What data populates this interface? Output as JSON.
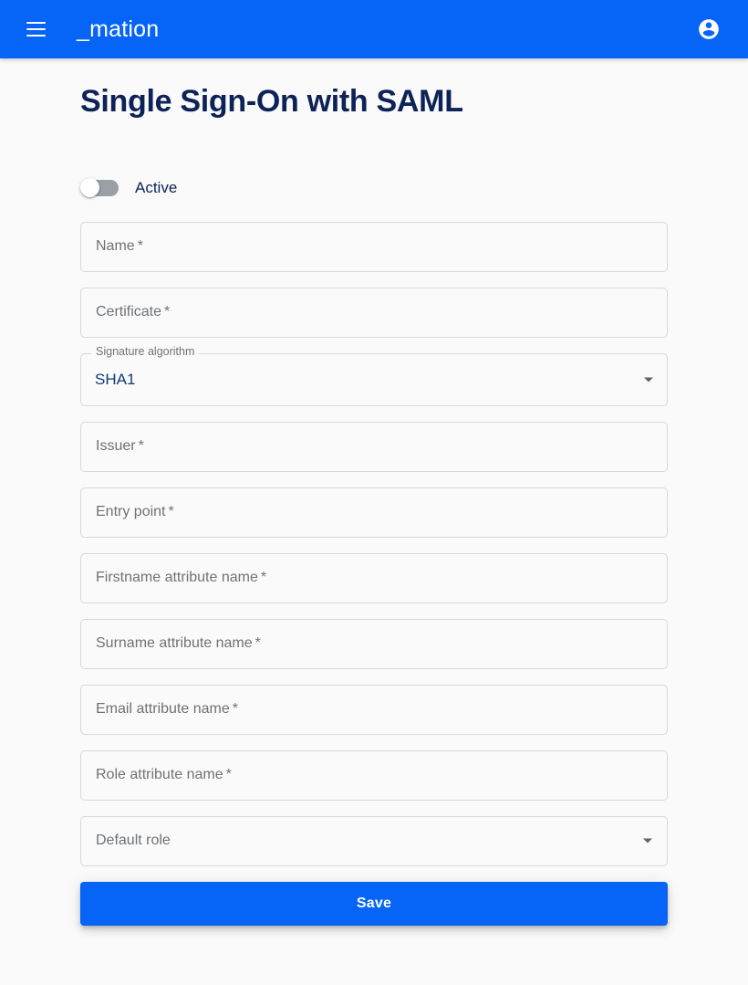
{
  "appbar": {
    "menu_label": "Menu",
    "brand": "_mation",
    "account_label": "Account",
    "background_color": "#0664f7"
  },
  "page": {
    "title": "Single Sign-On with SAML",
    "title_color": "#0d2257",
    "background_color": "#fafafa"
  },
  "toggle": {
    "label": "Active",
    "state": "off",
    "track_color": "#9aa0a6",
    "knob_color": "#ffffff"
  },
  "form": {
    "fields": [
      {
        "name": "name",
        "placeholder": "Name",
        "required_mark": "*",
        "value": "",
        "type": "text"
      },
      {
        "name": "certificate",
        "placeholder": "Certificate",
        "required_mark": "*",
        "value": "",
        "type": "text"
      },
      {
        "name": "signature_algorithm",
        "placeholder": "Signature algorithm",
        "required_mark": "",
        "value": "SHA1",
        "type": "select"
      },
      {
        "name": "issuer",
        "placeholder": "Issuer",
        "required_mark": "*",
        "value": "",
        "type": "text"
      },
      {
        "name": "entry_point",
        "placeholder": "Entry point",
        "required_mark": "*",
        "value": "",
        "type": "text"
      },
      {
        "name": "firstname_attribute_name",
        "placeholder": "Firstname attribute name",
        "required_mark": "*",
        "value": "",
        "type": "text"
      },
      {
        "name": "surname_attribute_name",
        "placeholder": "Surname attribute name",
        "required_mark": "*",
        "value": "",
        "type": "text"
      },
      {
        "name": "email_attribute_name",
        "placeholder": "Email attribute name",
        "required_mark": "*",
        "value": "",
        "type": "text"
      },
      {
        "name": "role_attribute_name",
        "placeholder": "Role attribute name",
        "required_mark": "*",
        "value": "",
        "type": "text"
      },
      {
        "name": "default_role",
        "placeholder": "Default role",
        "required_mark": "",
        "value": "",
        "type": "select"
      }
    ],
    "field_labels": {
      "name": "Name",
      "name_req": "*",
      "certificate": "Certificate",
      "certificate_req": "*",
      "signature_algorithm_label": "Signature algorithm",
      "signature_algorithm_value": "SHA1",
      "issuer": "Issuer",
      "issuer_req": "*",
      "entry_point": "Entry point",
      "entry_point_req": "*",
      "firstname_attribute_name": "Firstname attribute name",
      "firstname_attribute_name_req": "*",
      "surname_attribute_name": "Surname attribute name",
      "surname_attribute_name_req": "*",
      "email_attribute_name": "Email attribute name",
      "email_attribute_name_req": "*",
      "role_attribute_name": "Role attribute name",
      "role_attribute_name_req": "*",
      "default_role": "Default role"
    },
    "save_label": "Save",
    "save_color": "#0664f7"
  }
}
